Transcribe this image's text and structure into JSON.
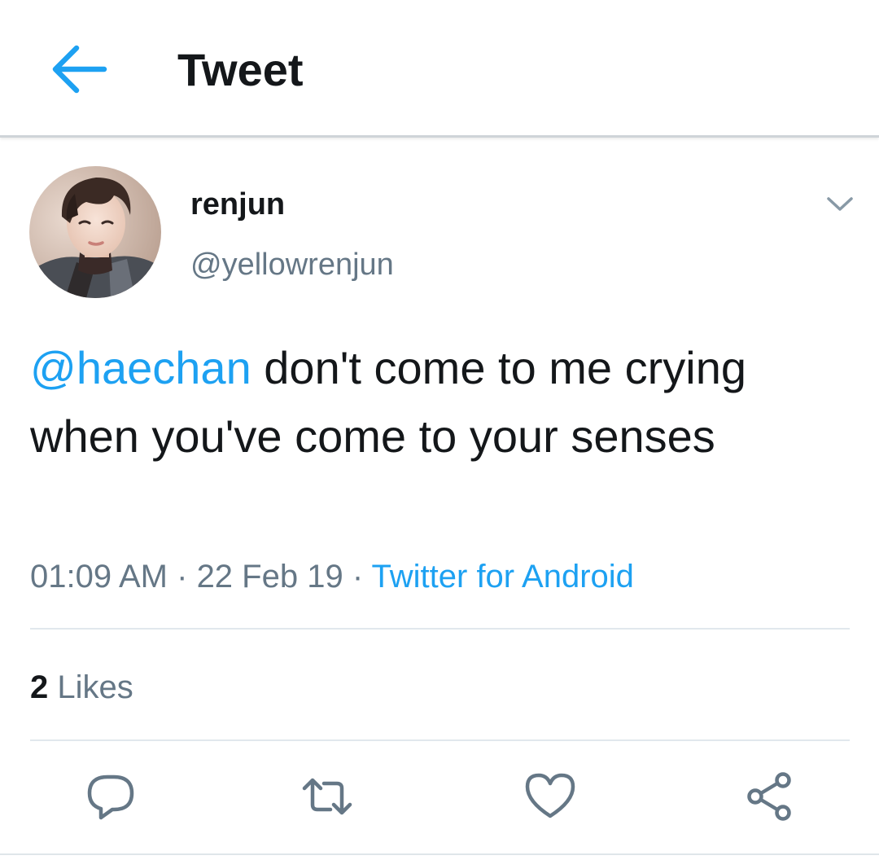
{
  "header": {
    "title": "Tweet",
    "back_icon": "arrow-left-icon",
    "accent_color": "#1da1f2"
  },
  "tweet": {
    "author": {
      "display_name": "renjun",
      "handle": "@yellowrenjun",
      "avatar_icon": "profile-photo"
    },
    "mention": "@haechan",
    "text": " don't come to me crying when you've come to your senses",
    "time": "01:09 AM",
    "separator": " · ",
    "date": "22 Feb 19",
    "source": "Twitter for Android",
    "likes_count": "2",
    "likes_label": "Likes"
  },
  "actions": [
    {
      "name": "reply",
      "icon": "reply-icon"
    },
    {
      "name": "retweet",
      "icon": "retweet-icon"
    },
    {
      "name": "like",
      "icon": "heart-icon"
    },
    {
      "name": "share",
      "icon": "share-icon"
    }
  ],
  "colors": {
    "text_primary": "#14171a",
    "text_secondary": "#657786",
    "link": "#1da1f2",
    "divider": "#e1e8ed"
  }
}
